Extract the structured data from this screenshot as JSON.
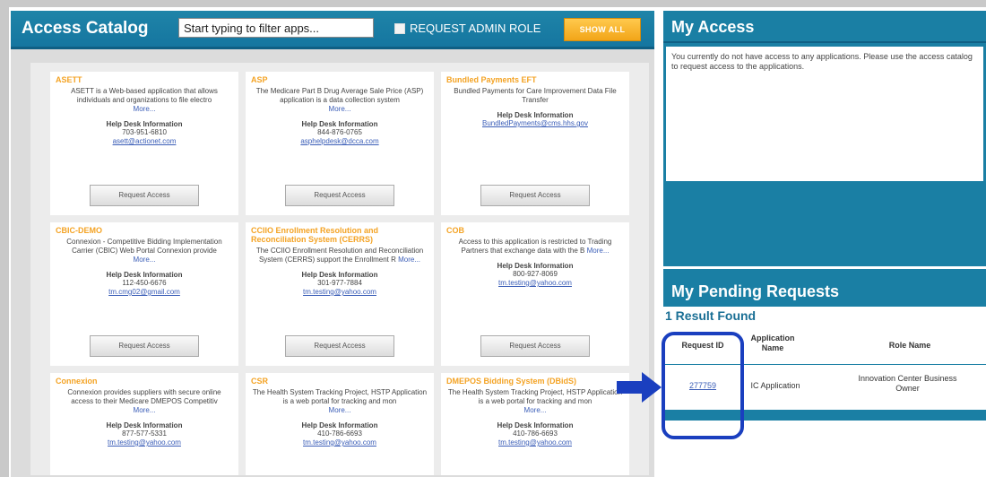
{
  "catalog": {
    "title": "Access Catalog",
    "filter_placeholder": "Start typing to filter apps...",
    "admin_role_label": "REQUEST ADMIN ROLE",
    "show_all_label": "SHOW ALL",
    "cards": [
      {
        "title": "ASETT",
        "desc": "ASETT is a Web-based application that allows individuals and organizations to file electro",
        "more": "More...",
        "help_title": "Help Desk Information",
        "phone": "703-951-6810",
        "email": "asett@actionet.com",
        "button": "Request Access"
      },
      {
        "title": "ASP",
        "desc": "The Medicare Part B Drug Average Sale Price (ASP) application is a data collection system",
        "more": "More...",
        "help_title": "Help Desk Information",
        "phone": "844-876-0765",
        "email": "asphelpdesk@dcca.com",
        "button": "Request Access"
      },
      {
        "title": "Bundled Payments EFT",
        "desc": "Bundled Payments for Care Improvement Data File Transfer",
        "more": "",
        "help_title": "Help Desk Information",
        "phone": "",
        "email": "BundledPayments@cms.hhs.gov",
        "button": "Request Access"
      },
      {
        "title": "CBIC-DEMO",
        "desc": "Connexion - Competitive Bidding Implementation Carrier (CBIC) Web Portal Connexion provide",
        "more": "More...",
        "help_title": "Help Desk Information",
        "phone": "112-450-6676",
        "email": "tm.cmg02@gmail.com",
        "button": "Request Access"
      },
      {
        "title": "CCIIO Enrollment Resolution and Reconciliation System (CERRS)",
        "desc": "The CCIIO Enrollment Resolution and Reconciliation System (CERRS) support the Enrollment R",
        "more": "More...",
        "help_title": "Help Desk Information",
        "phone": "301-977-7884",
        "email": "tm.testing@yahoo.com",
        "button": "Request Access"
      },
      {
        "title": "COB",
        "desc": "Access to this application is restricted to Trading Partners that exchange data with the B",
        "more": "More...",
        "help_title": "Help Desk Information",
        "phone": "800-927-8069",
        "email": "tm.testing@yahoo.com",
        "button": "Request Access"
      },
      {
        "title": "Connexion",
        "desc": "Connexion provides suppliers with secure online access to their Medicare DMEPOS Competitiv",
        "more": "More...",
        "help_title": "Help Desk Information",
        "phone": "877-577-5331",
        "email": "tm.testing@yahoo.com",
        "button": ""
      },
      {
        "title": "CSR",
        "desc": "The Health System Tracking Project, HSTP Application is a web portal for tracking and mon",
        "more": "More...",
        "help_title": "Help Desk Information",
        "phone": "410-786-6693",
        "email": "tm.testing@yahoo.com",
        "button": ""
      },
      {
        "title": "DMEPOS Bidding System (DBidS)",
        "desc": "The Health System Tracking Project, HSTP Application is a web portal for tracking and mon",
        "more": "More...",
        "help_title": "Help Desk Information",
        "phone": "410-786-6693",
        "email": "tm.testing@yahoo.com",
        "button": ""
      }
    ]
  },
  "my_access": {
    "title": "My Access",
    "message": "You currently do not have access to any applications. Please use the access catalog to request access to the applications."
  },
  "pending": {
    "title": "My Pending Requests",
    "result_count": "1 Result Found",
    "columns": [
      "Request ID",
      "Application Name",
      "Role Name"
    ],
    "rows": [
      {
        "request_id": "277759",
        "app_name": "IC Application",
        "role_name": "Innovation Center Business Owner"
      }
    ]
  },
  "colors": {
    "header_blue": "#1a7fa4",
    "title_orange": "#f4a324",
    "highlight_blue": "#1a3fbf"
  }
}
